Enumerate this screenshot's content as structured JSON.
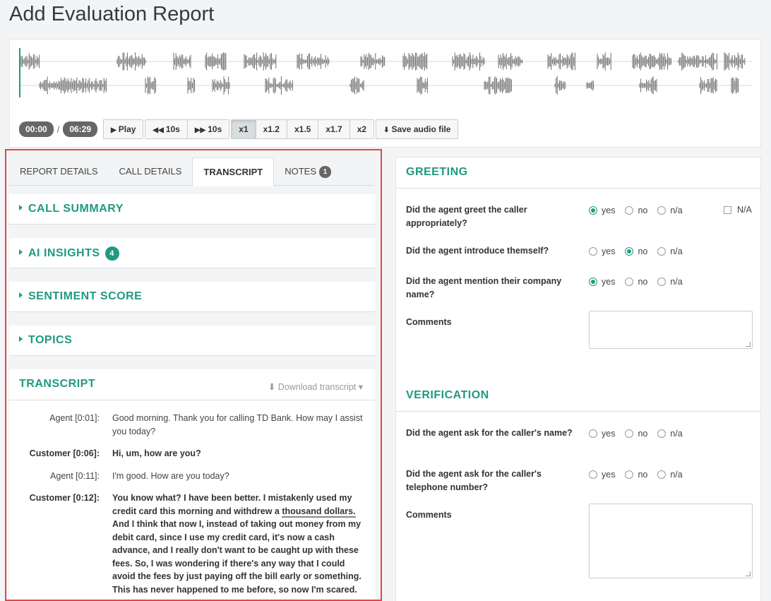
{
  "page": {
    "title": "Add Evaluation Report"
  },
  "player": {
    "current_time": "00:00",
    "separator": "/",
    "duration": "06:29",
    "play_label": "Play",
    "rewind_label": "10s",
    "forward_label": "10s",
    "speeds": [
      "x1",
      "x1.2",
      "x1.5",
      "x1.7",
      "x2"
    ],
    "active_speed": "x1",
    "save_label": "Save audio file",
    "progress": 0,
    "waveform_color": "#6b6b6b",
    "playhead_color": "#1f9a80"
  },
  "tabs": [
    {
      "label": "REPORT DETAILS",
      "active": false
    },
    {
      "label": "CALL DETAILS",
      "active": false
    },
    {
      "label": "TRANSCRIPT",
      "active": true
    },
    {
      "label": "NOTES",
      "active": false,
      "badge": "1"
    }
  ],
  "accordions": [
    {
      "title": "CALL SUMMARY"
    },
    {
      "title": "AI INSIGHTS",
      "badge": "4"
    },
    {
      "title": "SENTIMENT SCORE"
    },
    {
      "title": "TOPICS"
    }
  ],
  "transcript": {
    "title": "TRANSCRIPT",
    "download_label": "Download transcript",
    "rows": [
      {
        "speaker": "Agent [0:01]:",
        "text": "Good morning. Thank you for calling TD Bank. How may I assist you today?",
        "customer": false
      },
      {
        "speaker": "Customer [0:06]:",
        "text": "Hi, um, how are you?",
        "customer": true
      },
      {
        "speaker": "Agent [0:11]:",
        "text": "I'm good. How are you today?",
        "customer": false
      },
      {
        "speaker": "Customer [0:12]:",
        "text_before": "You know what? I have been better. I mistakenly used my credit card this morning and withdrew a ",
        "highlight": "thousand dollars.",
        "text_after": " And I think that now I, instead of taking out money from my debit card, since I use my credit card, it's now a cash advance, and I really don't want to be caught up with these fees. So, I was wondering if there's any way that I could avoid the fees by just paying off the bill early or something. This has never happened to me before, so now I'm scared.",
        "customer": true
      }
    ]
  },
  "evaluation": {
    "sections": [
      {
        "title": "GREETING",
        "questions": [
          {
            "text": "Did the agent greet the caller appropriately?",
            "selected": "yes"
          },
          {
            "text": "Did the agent introduce themself?",
            "selected": "no"
          },
          {
            "text": "Did the agent mention their company name?",
            "selected": "yes"
          }
        ],
        "na_label": "N/A",
        "comments_label": "Comments"
      },
      {
        "title": "VERIFICATION",
        "questions": [
          {
            "text": "Did the agent ask for the caller's name?",
            "selected": ""
          },
          {
            "text": "Did the agent ask for the caller's telephone number?",
            "selected": ""
          }
        ],
        "comments_label": "Comments"
      }
    ],
    "options": [
      "yes",
      "no",
      "n/a"
    ]
  },
  "colors": {
    "accent": "#1f9a80",
    "highlight_border": "#e04848"
  }
}
